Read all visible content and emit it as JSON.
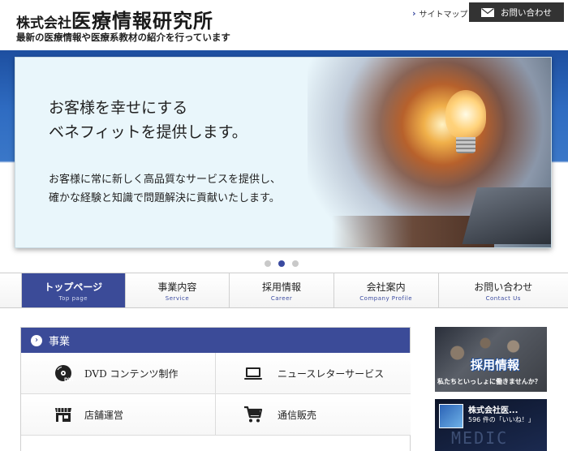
{
  "header": {
    "title_small": "株式会社",
    "title_big": "医療情報研究所",
    "subtitle": "最新の医療情報や医療系教材の紹介を行っています",
    "sitemap_label": "サイトマップ",
    "contact_button_label": "お問い合わせ"
  },
  "hero": {
    "headline_line1": "お客様を幸せにする",
    "headline_line2": "ベネフィットを提供します。",
    "body_line1": "お客様に常に新しく高品質なサービスを提供し、",
    "body_line2": "確かな経験と知識で問題解決に貢献いたします。",
    "slider_total": 3,
    "slider_active_index": 1
  },
  "nav": {
    "items": [
      {
        "jp": "トップページ",
        "en": "Top page",
        "active": true
      },
      {
        "jp": "事業内容",
        "en": "Service",
        "active": false
      },
      {
        "jp": "採用情報",
        "en": "Career",
        "active": false
      },
      {
        "jp": "会社案内",
        "en": "Company Profile",
        "active": false
      },
      {
        "jp": "お問い合わせ",
        "en": "Contact Us",
        "active": false
      }
    ]
  },
  "business": {
    "heading": "事業",
    "items": [
      {
        "label": "DVD コンテンツ制作",
        "icon": "dvd-icon"
      },
      {
        "label": "ニュースレターサービス",
        "icon": "laptop-icon"
      },
      {
        "label": "店舗運営",
        "icon": "store-icon"
      },
      {
        "label": "通信販売",
        "icon": "cart-icon"
      }
    ]
  },
  "sidebar": {
    "recruit_banner": {
      "title": "採用情報",
      "caption": "私たちといっしょに働きませんか？"
    },
    "facebook_banner": {
      "name": "株式会社医...",
      "likes": "596 件の「いいね！」",
      "watermark": "MEDIC"
    }
  },
  "colors": {
    "accent": "#3b4b98",
    "header_dark": "#333333"
  }
}
